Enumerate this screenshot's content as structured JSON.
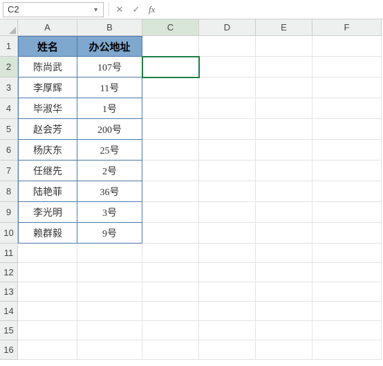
{
  "formula_bar": {
    "name_box": "C2",
    "cancel_icon": "✕",
    "confirm_icon": "✓",
    "fx_label": "fx",
    "formula_value": ""
  },
  "columns": [
    {
      "label": "A",
      "width": 86
    },
    {
      "label": "B",
      "width": 94
    },
    {
      "label": "C",
      "width": 82
    },
    {
      "label": "D",
      "width": 82
    },
    {
      "label": "E",
      "width": 82
    },
    {
      "label": "F",
      "width": 100
    }
  ],
  "row_heights": {
    "header": 30,
    "data": 30,
    "empty": 28
  },
  "visible_rows": 16,
  "active_cell": {
    "col": 2,
    "row": 1
  },
  "table": {
    "headers": [
      "姓名",
      "办公地址"
    ],
    "rows": [
      [
        "陈尚武",
        "107号"
      ],
      [
        "李厚辉",
        "11号"
      ],
      [
        "毕淑华",
        "1号"
      ],
      [
        "赵会芳",
        "200号"
      ],
      [
        "杨庆东",
        "25号"
      ],
      [
        "任继先",
        "2号"
      ],
      [
        "陆艳菲",
        "36号"
      ],
      [
        "李光明",
        "3号"
      ],
      [
        "赖群毅",
        "9号"
      ]
    ]
  }
}
